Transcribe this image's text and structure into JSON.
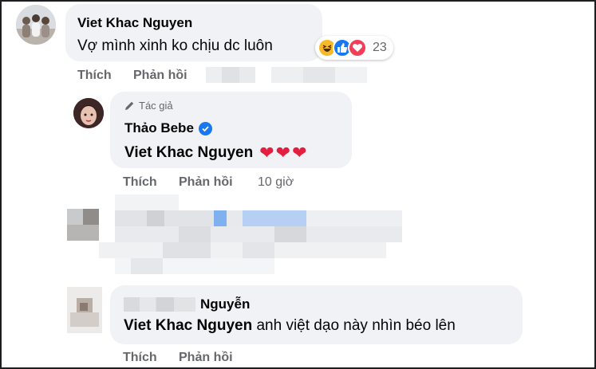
{
  "comment1": {
    "author": "Viet Khac Nguyen",
    "text": "Vợ mình xinh ko chịu dc luôn",
    "reaction_count": "23",
    "reaction_icons": [
      "haha-icon",
      "like-icon",
      "love-icon"
    ],
    "actions": {
      "like": "Thích",
      "reply": "Phản hồi"
    }
  },
  "reply1": {
    "badge": "Tác giả",
    "author": "Thảo Bebe",
    "mention": "Viet Khac Nguyen",
    "hearts": "❤❤❤",
    "actions": {
      "like": "Thích",
      "reply": "Phản hồi"
    },
    "time": "10 giờ"
  },
  "reply3": {
    "author_visible": "Nguyễn",
    "mention": "Viet Khac Nguyen",
    "text": "anh việt dạo này nhìn béo lên",
    "actions": {
      "like": "Thích",
      "reply": "Phản hồi"
    }
  },
  "colors": {
    "bubble": "#f0f2f5",
    "secondary_text": "#65676b",
    "verified": "#1877f2",
    "heart": "#e41e3f"
  }
}
